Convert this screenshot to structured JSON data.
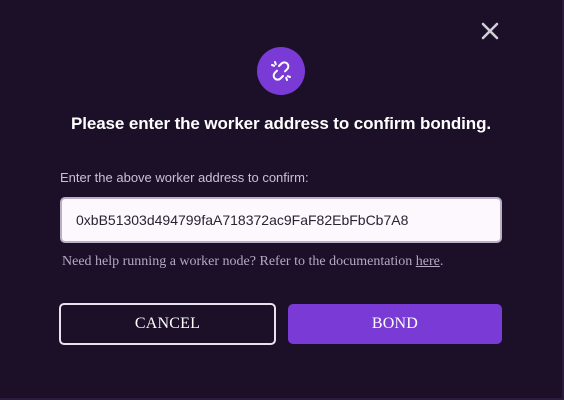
{
  "dialog": {
    "title": "Please enter the worker address to confirm bonding.",
    "field_label": "Enter the above worker address to confirm:",
    "address_value": "0xbB51303d494799faA718372ac9FaF82EbFbCb7A8",
    "help_text": "Need help running a worker node? Refer to the documentation ",
    "help_link": "here",
    "help_suffix": ".",
    "cancel_label": "CANCEL",
    "bond_label": "BOND"
  },
  "icons": {
    "close": "close-icon",
    "header": "unlink-icon"
  },
  "colors": {
    "background": "#1c1029",
    "accent": "#7a3ad6",
    "text": "#ffffff",
    "muted": "#c9bfd6"
  }
}
